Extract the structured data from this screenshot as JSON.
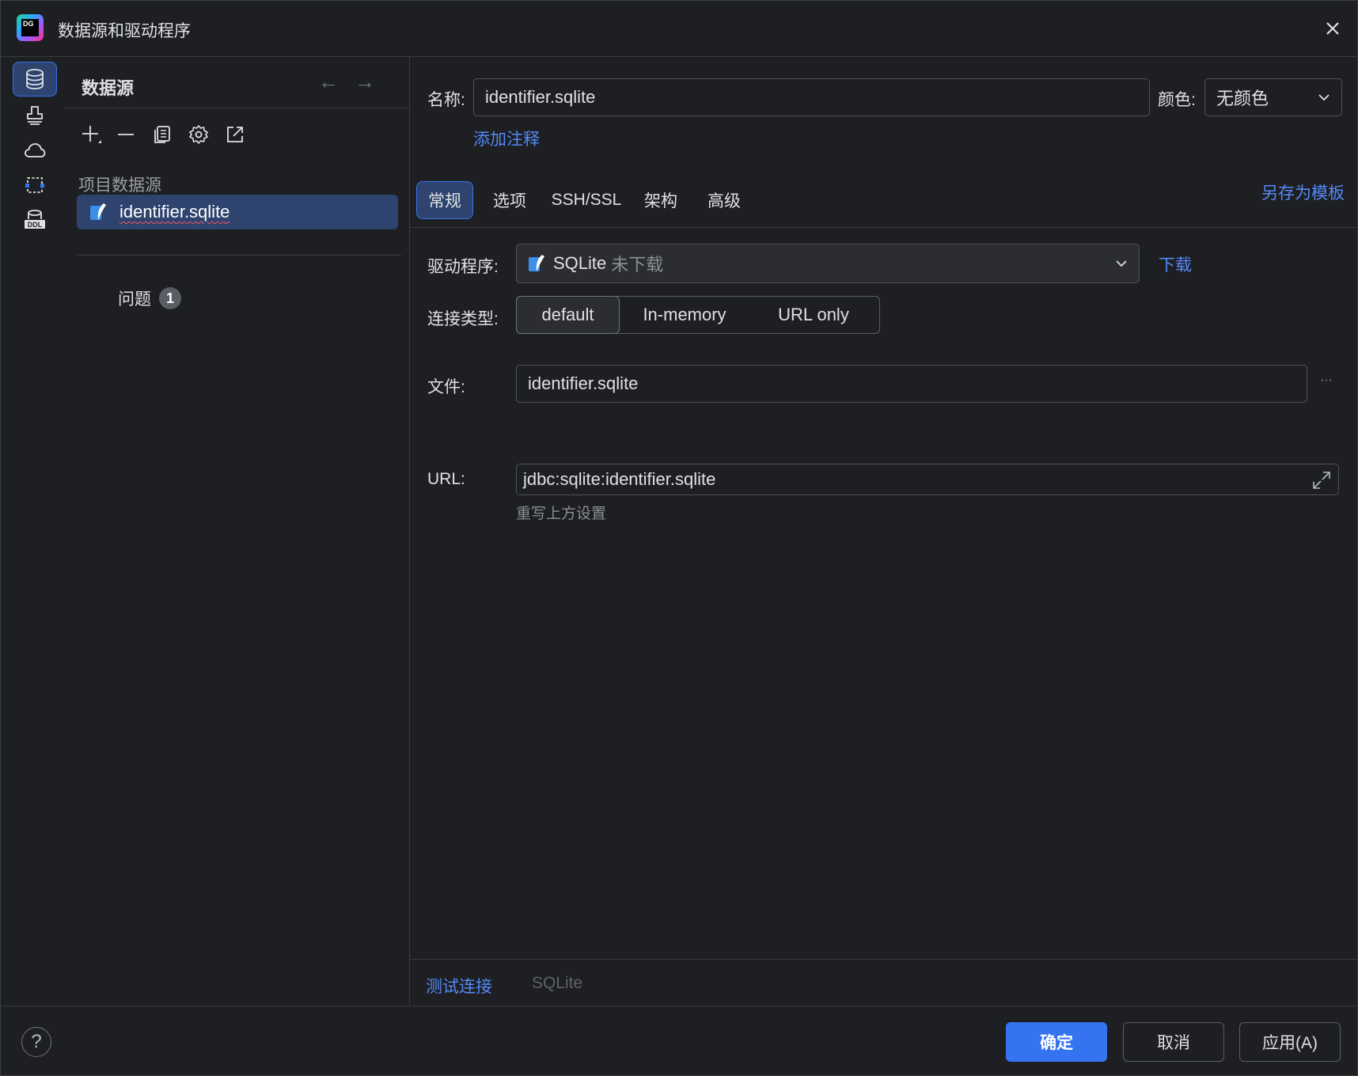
{
  "window": {
    "title": "数据源和驱动程序"
  },
  "sidebar": {
    "title": "数据源",
    "group_label": "项目数据源",
    "selected_item": "identifier.sqlite",
    "problems_label": "问题",
    "problems_count": "1"
  },
  "main": {
    "name_label": "名称:",
    "name_value": "identifier.sqlite",
    "color_label": "颜色:",
    "color_value": "无颜色",
    "add_comment": "添加注释",
    "tabs": [
      {
        "label": "常规"
      },
      {
        "label": "选项"
      },
      {
        "label": "SSH/SSL"
      },
      {
        "label": "架构"
      },
      {
        "label": "高级"
      }
    ],
    "save_as_template": "另存为模板",
    "driver_label": "驱动程序:",
    "driver_name": "SQLite",
    "driver_status": "未下载",
    "download_link": "下载",
    "conn_type_label": "连接类型:",
    "conn_types": [
      {
        "label": "default"
      },
      {
        "label": "In-memory"
      },
      {
        "label": "URL only"
      }
    ],
    "file_label": "文件:",
    "file_value": "identifier.sqlite",
    "file_more": "···",
    "url_label": "URL:",
    "url_value": "jdbc:sqlite:identifier.sqlite",
    "override_hint": "重写上方设置",
    "test_connection": "测试连接",
    "driver_footer": "SQLite"
  },
  "footer": {
    "help": "?",
    "ok": "确定",
    "cancel": "取消",
    "apply": "应用(A)"
  },
  "colors": {
    "accent": "#3574f0",
    "selection": "#2e436e",
    "link": "#548af7",
    "background": "#1e1f22",
    "error_underline": "#f75464"
  }
}
